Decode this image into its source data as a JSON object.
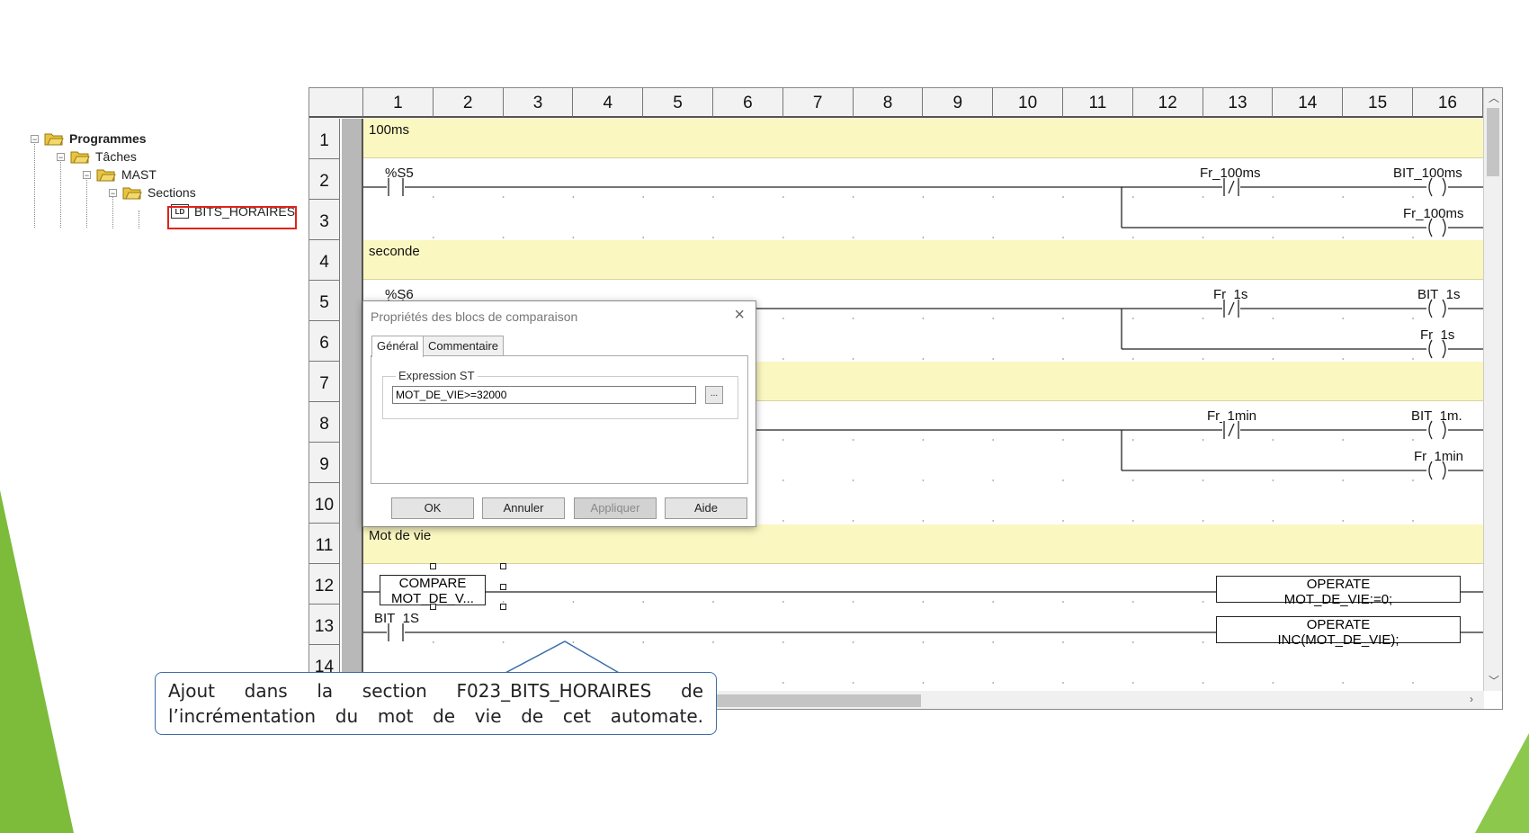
{
  "tree": {
    "items": [
      {
        "label": "Programmes",
        "bold": true
      },
      {
        "label": "Tâches",
        "bold": false
      },
      {
        "label": "MAST",
        "bold": false
      },
      {
        "label": "Sections",
        "bold": false
      },
      {
        "label": "BITS_HORAIRES",
        "bold": false,
        "icon": "LD"
      }
    ]
  },
  "grid": {
    "columns": [
      "1",
      "2",
      "3",
      "4",
      "5",
      "6",
      "7",
      "8",
      "9",
      "10",
      "11",
      "12",
      "13",
      "14",
      "15",
      "16"
    ],
    "rows": [
      "1",
      "2",
      "3",
      "4",
      "5",
      "6",
      "7",
      "8",
      "9",
      "10",
      "11",
      "12",
      "13",
      "14"
    ]
  },
  "ladder": {
    "comments": {
      "r1": "100ms",
      "r4": "seconde",
      "r11": "Mot de vie"
    },
    "labels": {
      "s5": "%S5",
      "fr100_a": "Fr_100ms",
      "bit100": "BIT_100ms",
      "fr100_b": "Fr_100ms",
      "s6": "%S6",
      "fr1s_a": "Fr_1s",
      "bit1s": "BIT_1s",
      "fr1s_b": "Fr_1s",
      "fr1min_a": "Fr_1min",
      "bit1min": "BIT_1m.",
      "fr1min_b": "Fr_1min",
      "bit1s_contact": "BIT_1S"
    },
    "compare_block": {
      "title": "COMPARE",
      "expr": "MOT_DE_V..."
    },
    "operate_1": {
      "title": "OPERATE",
      "expr": "MOT_DE_VIE:=0;"
    },
    "operate_2": {
      "title": "OPERATE",
      "expr": "INC(MOT_DE_VIE);"
    }
  },
  "dialog": {
    "title": "Propriétés des blocs de comparaison",
    "tabs": [
      "Général",
      "Commentaire"
    ],
    "group_label": "Expression ST",
    "expression_value": "MOT_DE_VIE>=32000",
    "browse_label": "...",
    "buttons": {
      "ok": "OK",
      "cancel": "Annuler",
      "apply": "Appliquer",
      "help": "Aide"
    }
  },
  "callout": {
    "text": "Ajout dans la section F023_BITS_HORAIRES de l’incrémentation du mot de vie de cet automate."
  },
  "colors": {
    "comment_bg": "#fbf7c0",
    "highlight": "#e0231c",
    "accent_green": "#7dbb3a",
    "callout_border": "#3b6ea8"
  }
}
